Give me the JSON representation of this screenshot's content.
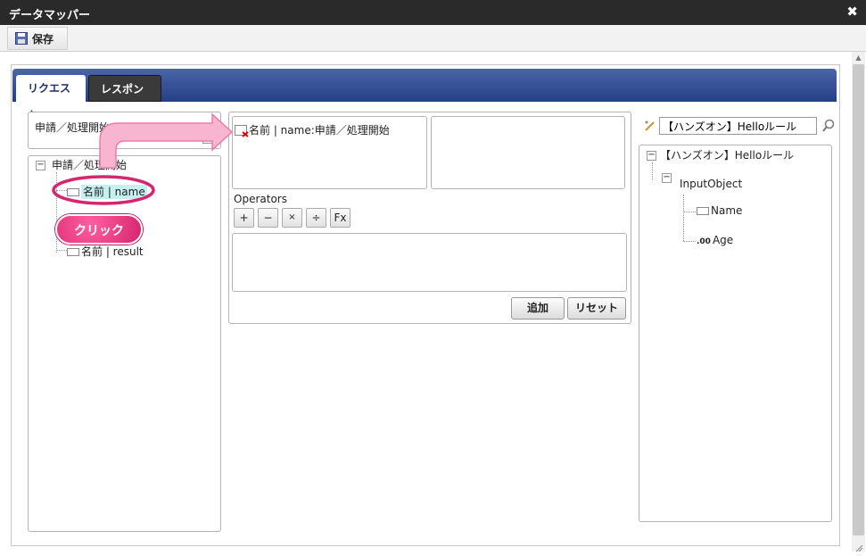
{
  "window": {
    "title": "データマッパー",
    "close_glyph": "✖"
  },
  "toolbar": {
    "save_label": "保存",
    "save_icon": "floppy-disk-icon"
  },
  "tabs": [
    {
      "label": "リクエスト",
      "active": true
    },
    {
      "label": "レスポンス",
      "active": false
    }
  ],
  "left": {
    "selected_label": "申請／処理開始",
    "tree": {
      "root": "申請／処理開始",
      "items": [
        "名前 | name",
        "名前 | result"
      ]
    }
  },
  "center": {
    "expression": "名前 | name:申請／処理開始",
    "operators_label": "Operators",
    "operators": [
      "+",
      "−",
      "×",
      "÷",
      "Fx"
    ],
    "add_button": "追加",
    "reset_button": "リセット"
  },
  "right": {
    "search_value": "【ハンズオン】Helloルール",
    "tree": {
      "root": "【ハンズオン】Helloルール",
      "child": "InputObject",
      "fields": [
        "Name",
        "Age"
      ],
      "age_icon_text": ".00"
    }
  },
  "annotation": {
    "callout": "クリック"
  },
  "colors": {
    "tab_bar": "#2f4b92",
    "highlight": "#c6f0f0",
    "callout": "#e8377f",
    "arrow": "#f7a8c8"
  }
}
